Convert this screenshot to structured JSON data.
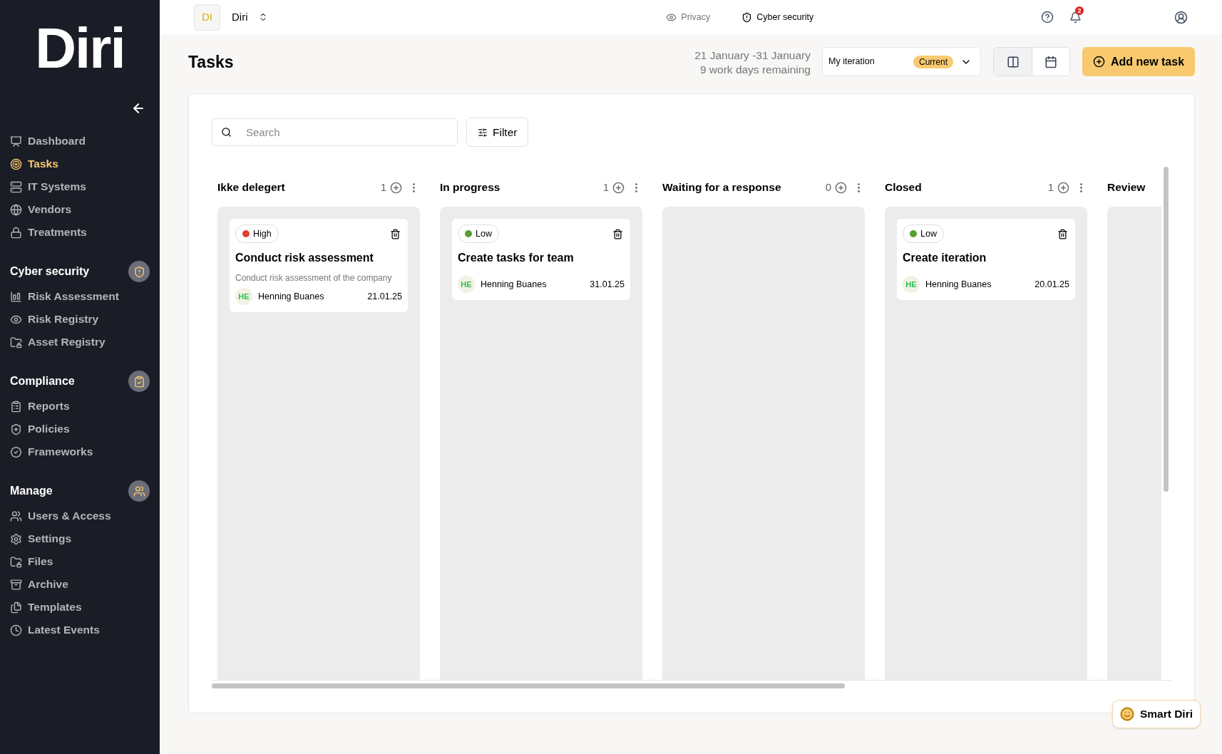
{
  "sidebar": {
    "logo": "Diri",
    "sections": [
      {
        "items": [
          {
            "label": "Dashboard",
            "selected": false
          },
          {
            "label": "Tasks",
            "selected": true
          },
          {
            "label": "IT Systems",
            "selected": false
          },
          {
            "label": "Vendors",
            "selected": false
          },
          {
            "label": "Treatments",
            "selected": false
          }
        ]
      },
      {
        "title": "Cyber security",
        "items": [
          {
            "label": "Risk Assessment",
            "selected": false
          },
          {
            "label": "Risk Registry",
            "selected": false
          },
          {
            "label": "Asset Registry",
            "selected": false
          }
        ]
      },
      {
        "title": "Compliance",
        "items": [
          {
            "label": "Reports",
            "selected": false
          },
          {
            "label": "Policies",
            "selected": false
          },
          {
            "label": "Frameworks",
            "selected": false
          }
        ]
      },
      {
        "title": "Manage",
        "items": [
          {
            "label": "Users & Access",
            "selected": false
          },
          {
            "label": "Settings",
            "selected": false
          },
          {
            "label": "Files",
            "selected": false
          },
          {
            "label": "Archive",
            "selected": false
          },
          {
            "label": "Templates",
            "selected": false
          },
          {
            "label": "Latest Events",
            "selected": false
          }
        ]
      }
    ]
  },
  "topbar": {
    "org_initials": "DI",
    "org_name": "Diri",
    "modes": [
      {
        "label": "Privacy",
        "selected": false
      },
      {
        "label": "Cyber security",
        "selected": true
      }
    ],
    "notification_count": "2"
  },
  "header": {
    "title": "Tasks",
    "date_range": "21 January -31 January",
    "remaining": "9 work days remaining",
    "iteration": {
      "value": "My iteration",
      "badge": "Current"
    },
    "views": [
      {
        "kind": "board",
        "selected": true
      },
      {
        "kind": "calendar",
        "selected": false
      }
    ],
    "add_button": "Add new task"
  },
  "toolbar": {
    "search_placeholder": "Search",
    "filter": "Filter"
  },
  "columns": [
    {
      "title": "Ikke delegert",
      "count": "1",
      "cards": [
        {
          "priority": "High",
          "color": "#d9432f",
          "title": "Conduct risk assessment",
          "description": "Conduct risk assessment of the company",
          "initials": "HE",
          "assignee": "Henning Buanes",
          "date": "21.01.25"
        }
      ]
    },
    {
      "title": "In progress",
      "count": "1",
      "cards": [
        {
          "priority": "Low",
          "color": "#5a9e2f",
          "title": "Create tasks for team",
          "initials": "HE",
          "assignee": "Henning Buanes",
          "date": "31.01.25"
        }
      ]
    },
    {
      "title": "Waiting for a response",
      "count": "0"
    },
    {
      "title": "Closed",
      "count": "1",
      "cards": [
        {
          "priority": "Low",
          "color": "#5a9e2f",
          "title": "Create iteration",
          "initials": "HE",
          "assignee": "Henning Buanes",
          "date": "20.01.25"
        }
      ]
    },
    {
      "title": "Review"
    }
  ],
  "assistant_button": "Smart Diri"
}
